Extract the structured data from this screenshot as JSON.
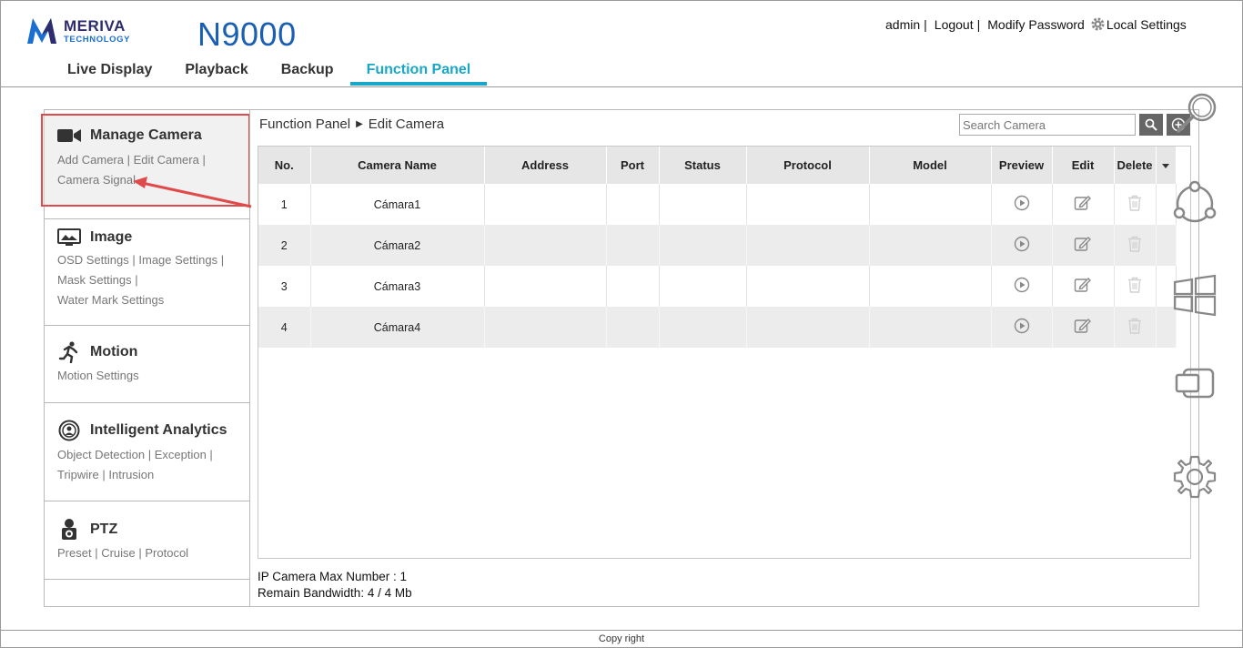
{
  "header": {
    "logo_name": "MERIVA",
    "logo_sub": "TECHNOLOGY",
    "product": "N9000",
    "user": "admin",
    "links": [
      "Logout",
      "Modify Password",
      "Local Settings"
    ]
  },
  "nav": {
    "tabs": [
      "Live Display",
      "Playback",
      "Backup",
      "Function Panel"
    ],
    "active": "Function Panel"
  },
  "sidebar": {
    "sections": [
      {
        "title": "Manage Camera",
        "icon": "video-camera-icon",
        "links": [
          "Add Camera",
          "Edit Camera",
          "Camera Signal"
        ]
      },
      {
        "title": "Image",
        "icon": "monitor-image-icon",
        "links": [
          "OSD Settings",
          "Image Settings",
          "Mask Settings",
          "Water Mark Settings"
        ]
      },
      {
        "title": "Motion",
        "icon": "running-person-icon",
        "links": [
          "Motion Settings"
        ]
      },
      {
        "title": "Intelligent Analytics",
        "icon": "analytics-icon",
        "links": [
          "Object Detection",
          "Exception",
          "Tripwire",
          "Intrusion"
        ]
      },
      {
        "title": "PTZ",
        "icon": "ptz-camera-icon",
        "links": [
          "Preset",
          "Cruise",
          "Protocol"
        ]
      }
    ]
  },
  "breadcrumb": {
    "root": "Function Panel",
    "current": "Edit Camera"
  },
  "search": {
    "placeholder": "Search Camera"
  },
  "table": {
    "columns": [
      "No.",
      "Camera Name",
      "Address",
      "Port",
      "Status",
      "Protocol",
      "Model",
      "Preview",
      "Edit",
      "Delete"
    ],
    "rows": [
      {
        "no": "1",
        "name": "Cámara1",
        "address": "",
        "port": "",
        "status": "",
        "protocol": "",
        "model": ""
      },
      {
        "no": "2",
        "name": "Cámara2",
        "address": "",
        "port": "",
        "status": "",
        "protocol": "",
        "model": ""
      },
      {
        "no": "3",
        "name": "Cámara3",
        "address": "",
        "port": "",
        "status": "",
        "protocol": "",
        "model": ""
      },
      {
        "no": "4",
        "name": "Cámara4",
        "address": "",
        "port": "",
        "status": "",
        "protocol": "",
        "model": ""
      }
    ]
  },
  "footer": {
    "max_number": "IP Camera Max Number : 1",
    "bandwidth": "Remain Bandwidth: 4 / 4 Mb",
    "copyright": "Copy right"
  },
  "colors": {
    "accent": "#19a7c9",
    "product": "#1a5fb4",
    "highlight": "#e14a4a"
  }
}
